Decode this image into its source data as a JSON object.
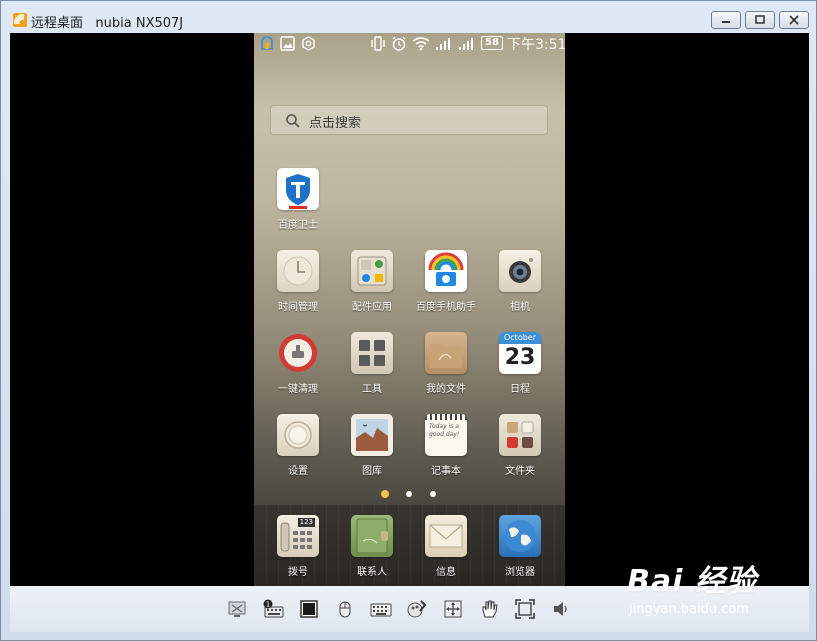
{
  "window": {
    "app_name": "远程桌面",
    "device_name": "nubia NX507J",
    "buttons": [
      "minimize",
      "maximize",
      "close"
    ]
  },
  "phone": {
    "status_bar": {
      "battery_level": "58",
      "time": "下午3:51",
      "icons": [
        "baidu-guard-icon",
        "image-notification-icon",
        "settings-notification-icon",
        "vibrate-icon",
        "alarm-icon",
        "wifi-icon",
        "signal-icon",
        "signal-icon"
      ]
    },
    "search": {
      "placeholder": "点击搜索"
    },
    "apps": [
      {
        "label": "百度卫士",
        "icon": "shield-icon"
      },
      {
        "label": "时间管理",
        "icon": "clock-icon"
      },
      {
        "label": "配件应用",
        "icon": "accessory-apps-icon"
      },
      {
        "label": "百度手机助手",
        "icon": "baidu-assistant-icon"
      },
      {
        "label": "相机",
        "icon": "camera-icon"
      },
      {
        "label": "一键清理",
        "icon": "clean-icon"
      },
      {
        "label": "工具",
        "icon": "tools-icon"
      },
      {
        "label": "我的文件",
        "icon": "folder-icon"
      },
      {
        "label": "日程",
        "icon": "calendar-icon",
        "calendar_month": "October",
        "calendar_day": "23"
      },
      {
        "label": "设置",
        "icon": "settings-dial-icon"
      },
      {
        "label": "图库",
        "icon": "gallery-icon"
      },
      {
        "label": "记事本",
        "icon": "notepad-icon",
        "note_text": "Today is a good day!"
      },
      {
        "label": "文件夹",
        "icon": "app-folder-icon"
      }
    ],
    "page_indicator": {
      "pages": 3,
      "current": 1
    },
    "dock": [
      {
        "label": "拨号",
        "icon": "phone-dialer-icon",
        "keypad_text": "123"
      },
      {
        "label": "联系人",
        "icon": "contacts-icon"
      },
      {
        "label": "信息",
        "icon": "messages-icon"
      },
      {
        "label": "浏览器",
        "icon": "browser-globe-icon"
      }
    ]
  },
  "toolbar": {
    "buttons": [
      "disconnect-icon",
      "screenshot-keyboard-icon",
      "screen-icon",
      "mouse-icon",
      "keyboard-icon",
      "paint-icon",
      "move-icon",
      "hand-icon",
      "fullscreen-icon",
      "volume-icon"
    ]
  },
  "watermark": {
    "logo": "Bai 经验",
    "url": "jingyan.baidu.com"
  },
  "colors": {
    "accent_dot": "#f2c14e",
    "window_chrome": "#dfe9f5",
    "viewport": "#000000"
  }
}
